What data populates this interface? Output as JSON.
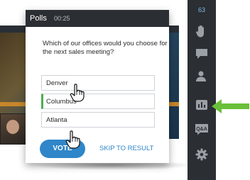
{
  "poll": {
    "title": "Polls",
    "timer": "00:25",
    "question": "Which of our offices would you choose for the next sales meeting?",
    "options": [
      {
        "label": "Denver",
        "selected": false
      },
      {
        "label": "Columbus",
        "selected": true
      },
      {
        "label": "Atlanta",
        "selected": false
      }
    ],
    "vote_label": "VOTE",
    "skip_label": "SKIP TO RESULT"
  },
  "sidebar": {
    "attendee_count": "63",
    "icons": [
      "raise-hand-icon",
      "chat-icon",
      "user-icon",
      "poll-icon",
      "qa-icon",
      "gear-icon"
    ],
    "qa_label": "Q&A"
  },
  "colors": {
    "accent": "#2f86c8",
    "selected": "#4caf50",
    "sidebar": "#2b2e33",
    "arrow": "#6abf3a"
  }
}
